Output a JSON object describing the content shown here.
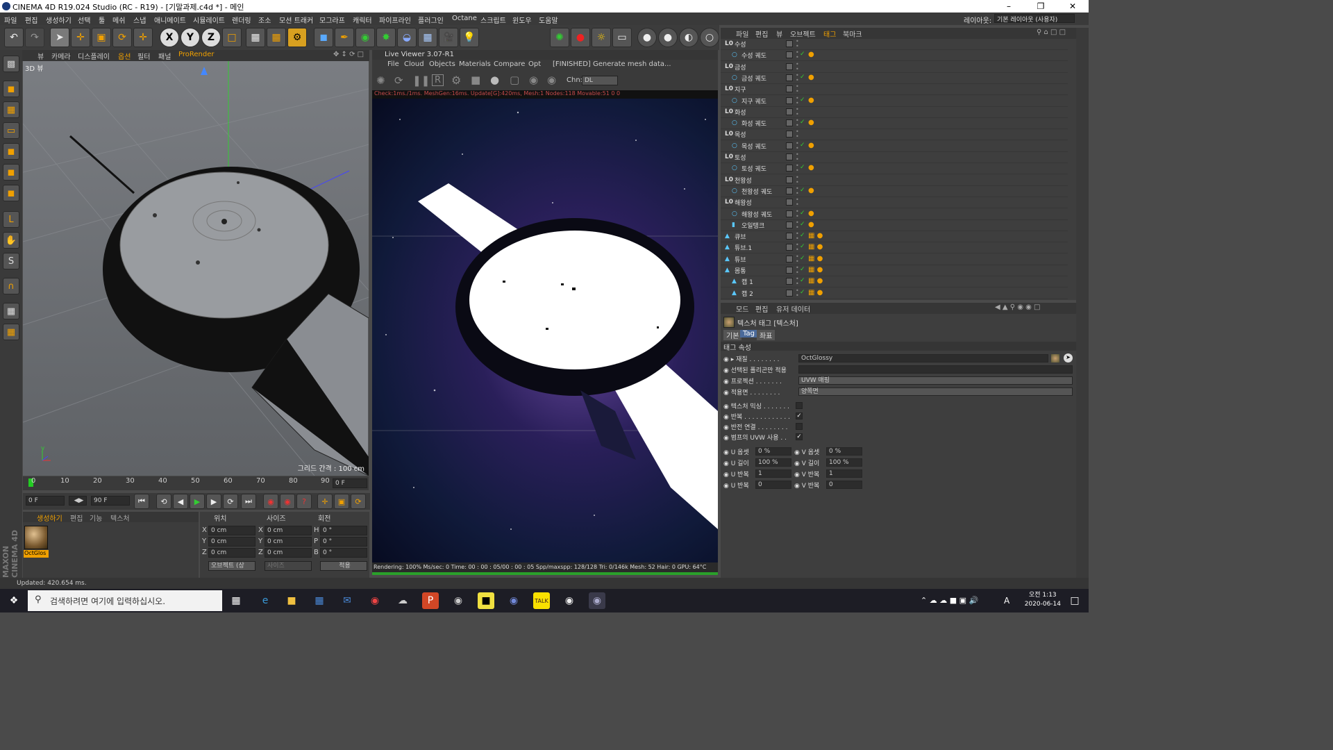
{
  "title": "CINEMA 4D R19.024 Studio (RC - R19) - [기말과제.c4d *] - 메인",
  "layout_label": "레이아웃:",
  "layout_value": "기본 레이아웃 (사용자)",
  "menu": [
    "파일",
    "편집",
    "생성하기",
    "선택",
    "툴",
    "메쉬",
    "스냅",
    "애니메이트",
    "시뮬레이트",
    "렌더링",
    "조소",
    "모션 트래커",
    "모그라프",
    "캐릭터",
    "파이프라인",
    "플러그인",
    "Octane",
    "스크립트",
    "윈도우",
    "도움말"
  ],
  "viewport": {
    "menu": [
      "뷰",
      "카메라",
      "디스플레이",
      "옵션",
      "필터",
      "패널",
      "ProRender"
    ],
    "label": "3D 뷰",
    "grid_info": "그리드 간격 : 100 cm"
  },
  "timeline": {
    "ticks": [
      "0",
      "10",
      "20",
      "30",
      "40",
      "50",
      "60",
      "70",
      "80",
      "90"
    ],
    "frame": "0 F",
    "start": "0 F",
    "end": "90 F"
  },
  "material_manager": {
    "menu": [
      "생성하기",
      "편집",
      "기능",
      "텍스처"
    ],
    "material_name": "OctGlos"
  },
  "coords": {
    "headers": [
      "위치",
      "사이즈",
      "회전"
    ],
    "rows": [
      {
        "axis": "X",
        "pos": "0 cm",
        "saxis": "X",
        "size": "0 cm",
        "raxis": "H",
        "rot": "0 °"
      },
      {
        "axis": "Y",
        "pos": "0 cm",
        "saxis": "Y",
        "size": "0 cm",
        "raxis": "P",
        "rot": "0 °"
      },
      {
        "axis": "Z",
        "pos": "0 cm",
        "saxis": "Z",
        "size": "0 cm",
        "raxis": "B",
        "rot": "0 °"
      }
    ],
    "mode": "오브젝트 (상",
    "size_mode": "사이즈",
    "apply": "적용"
  },
  "live_viewer": {
    "title": "Live Viewer 3.07-R1",
    "menu": [
      "File",
      "Cloud",
      "Objects",
      "Materials",
      "Compare",
      "Opt"
    ],
    "status_msg": "[FINISHED] Generate mesh data...",
    "chn_label": "Chn:",
    "chn_value": "DL",
    "stats": "Check:1ms./1ms. MeshGen:16ms. Update[G]:420ms, Mesh:1 Nodes:118 Movable:51  0 0",
    "footer": "Rendering: 100% Ms/sec: 0   Time: 00 : 00 : 05/00 : 00 : 05   Spp/maxspp: 128/128   Tri: 0/146k   Mesh: 52   Hair: 0   GPU:     64°C"
  },
  "object_manager": {
    "menu": [
      "파일",
      "편집",
      "뷰",
      "오브젝트",
      "태그",
      "북마크"
    ],
    "rows": [
      {
        "name": "수성",
        "indent": 1,
        "type": "null"
      },
      {
        "name": "수성 궤도",
        "indent": 2,
        "type": "circle"
      },
      {
        "name": "금성",
        "indent": 1,
        "type": "null"
      },
      {
        "name": "금성 궤도",
        "indent": 2,
        "type": "circle"
      },
      {
        "name": "지구",
        "indent": 1,
        "type": "null"
      },
      {
        "name": "지구 궤도",
        "indent": 2,
        "type": "circle"
      },
      {
        "name": "화성",
        "indent": 1,
        "type": "null"
      },
      {
        "name": "화성 궤도",
        "indent": 2,
        "type": "circle"
      },
      {
        "name": "목성",
        "indent": 1,
        "type": "null"
      },
      {
        "name": "목성 궤도",
        "indent": 2,
        "type": "circle"
      },
      {
        "name": "토성",
        "indent": 1,
        "type": "null"
      },
      {
        "name": "토성 궤도",
        "indent": 2,
        "type": "circle"
      },
      {
        "name": "천왕성",
        "indent": 1,
        "type": "null"
      },
      {
        "name": "천왕성 궤도",
        "indent": 2,
        "type": "circle"
      },
      {
        "name": "해왕성",
        "indent": 1,
        "type": "null"
      },
      {
        "name": "해왕성 궤도",
        "indent": 2,
        "type": "circle"
      },
      {
        "name": "오일탱크",
        "indent": 2,
        "type": "cyl"
      },
      {
        "name": "큐브",
        "indent": 1,
        "type": "obj"
      },
      {
        "name": "튜브.1",
        "indent": 1,
        "type": "obj"
      },
      {
        "name": "튜브",
        "indent": 1,
        "type": "obj"
      },
      {
        "name": "몸통",
        "indent": 1,
        "type": "obj"
      },
      {
        "name": "캡 1",
        "indent": 2,
        "type": "obj"
      },
      {
        "name": "캡 2",
        "indent": 2,
        "type": "obj"
      }
    ]
  },
  "attributes": {
    "menu": [
      "모드",
      "편집",
      "유저 데이터"
    ],
    "header": "텍스처 태그 [텍스처]",
    "tabs": [
      "기본",
      "Tag",
      "좌표"
    ],
    "section": "태그 속성",
    "material_label": "재질",
    "material_value": "OctGlossy",
    "selection_label": "선택된 폴리곤만 적용",
    "projection_label": "프로젝션",
    "projection_value": "UVW 매핑",
    "side_label": "적용면",
    "side_value": "양쪽면",
    "checks": [
      {
        "label": "텍스처 믹싱",
        "checked": false
      },
      {
        "label": "반복",
        "checked": true
      },
      {
        "label": "반전 연결",
        "checked": false
      },
      {
        "label": "범프의 UVW 사용",
        "checked": true
      }
    ],
    "uv": [
      {
        "l": "U 옵셋",
        "v": "0 %",
        "r": "V 옵셋",
        "rv": "0 %"
      },
      {
        "l": "U 길이",
        "v": "100 %",
        "r": "V 길이",
        "rv": "100 %"
      },
      {
        "l": "U 반복",
        "v": "1",
        "r": "V 반복",
        "rv": "1"
      },
      {
        "l": "U 반복",
        "v": "0",
        "r": "V 반복",
        "rv": "0"
      }
    ]
  },
  "status": "Updated: 420.654 ms.",
  "taskbar": {
    "search": "검색하려면 여기에 입력하십시오.",
    "time": "오전 1:13",
    "date": "2020-06-14",
    "ime": "A"
  },
  "colors": {
    "accent": "#f0a000",
    "render_progress": "#2aa02a"
  }
}
